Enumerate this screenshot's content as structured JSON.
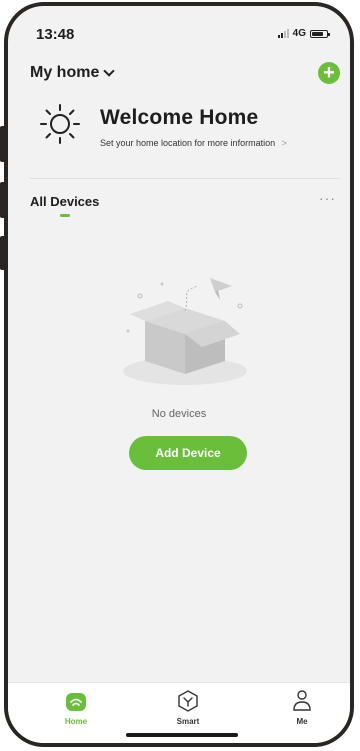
{
  "status_bar": {
    "time": "13:48",
    "network": "4G"
  },
  "header": {
    "home_label": "My home",
    "add_icon": "plus-icon"
  },
  "welcome": {
    "title": "Welcome Home",
    "subtitle": "Set your home location for more information",
    "subtitle_arrow": ">"
  },
  "devices": {
    "tab_label": "All Devices",
    "more": "···",
    "empty_text": "No devices",
    "add_button": "Add Device"
  },
  "tabbar": {
    "items": [
      {
        "label": "Home",
        "icon": "home-icon",
        "active": true
      },
      {
        "label": "Smart",
        "icon": "smart-icon",
        "active": false
      },
      {
        "label": "Me",
        "icon": "person-icon",
        "active": false
      }
    ]
  },
  "colors": {
    "accent": "#6abf3a",
    "background": "#f2f2f2",
    "frame": "#2a2623"
  }
}
